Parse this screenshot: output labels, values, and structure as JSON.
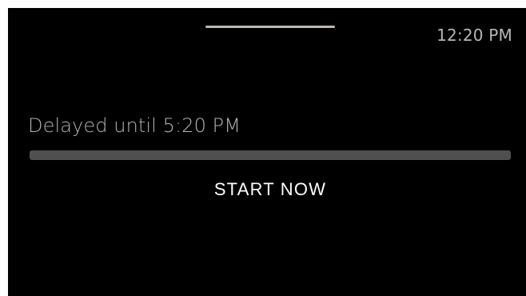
{
  "status_bar": {
    "time": "12:20 PM"
  },
  "delay": {
    "text": "Delayed until 5:20 PM",
    "progress": 0
  },
  "actions": {
    "start_now_label": "START NOW"
  },
  "colors": {
    "background": "#000000",
    "secondary_text": "#b3b3b3",
    "progress_track": "#4f4f4f",
    "button_text": "#ffffff",
    "handle": "#bdb8b0"
  }
}
